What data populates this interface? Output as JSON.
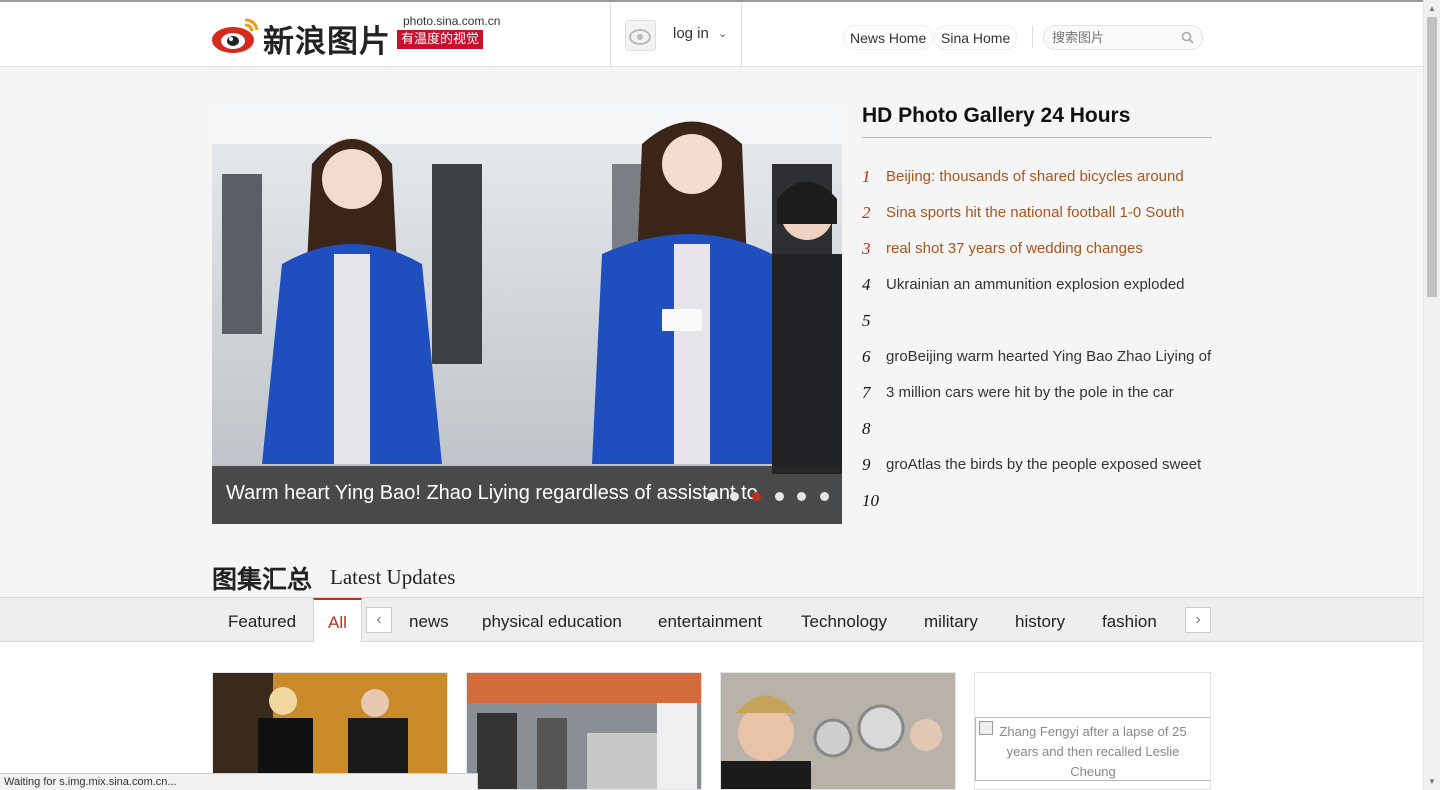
{
  "header": {
    "brand_text": "新浪图片",
    "domain": "photo.sina.com.cn",
    "slogan": "有温度的视觉",
    "login_label": "log in",
    "nav": [
      {
        "label": "News Home"
      },
      {
        "label": "Sina Home"
      }
    ],
    "search_placeholder": "搜索图片"
  },
  "hero": {
    "caption": "Warm heart Ying Bao! Zhao Liying regardless of assistant to",
    "slide_count": 6,
    "active_slide": 3
  },
  "top_list": {
    "title": "HD Photo Gallery 24 Hours",
    "items": [
      {
        "rank": "1",
        "text": "Beijing: thousands of shared bicycles around",
        "hot": true
      },
      {
        "rank": "2",
        "text": "Sina sports hit the national football 1-0 South",
        "hot": true
      },
      {
        "rank": "3",
        "text": "real shot 37 years of wedding changes",
        "hot": true
      },
      {
        "rank": "4",
        "text": "Ukrainian an ammunition explosion exploded",
        "hot": false
      },
      {
        "rank": "5",
        "text": "",
        "hot": false
      },
      {
        "rank": "6",
        "text": "groBeijing warm hearted Ying Bao Zhao Liying of big",
        "hot": false
      },
      {
        "rank": "7",
        "text": "3 million cars were hit by the pole in the car",
        "hot": false
      },
      {
        "rank": "8",
        "text": "",
        "hot": false
      },
      {
        "rank": "9",
        "text": "groAtlas the birds by the people exposed sweet",
        "hot": false
      },
      {
        "rank": "10",
        "text": "",
        "hot": false
      }
    ]
  },
  "section": {
    "title_cn": "图集汇总",
    "title_en": "Latest Updates"
  },
  "tabs": {
    "featured": "Featured",
    "active": "All",
    "prev_arrow": "‹",
    "next_arrow": "›",
    "items": [
      "news",
      "physical education",
      "entertainment",
      "Technology",
      "military",
      "history",
      "fashion"
    ]
  },
  "thumbnails": {
    "broken_alt": "Zhang Fengyi after a lapse of 25 years and then recalled Leslie Cheung"
  },
  "status_text": "Waiting for s.img.mix.sina.com.cn...",
  "colors": {
    "accent_red": "#c0311e",
    "hot_text": "#a8551f",
    "logo_red": "#c8102e"
  }
}
